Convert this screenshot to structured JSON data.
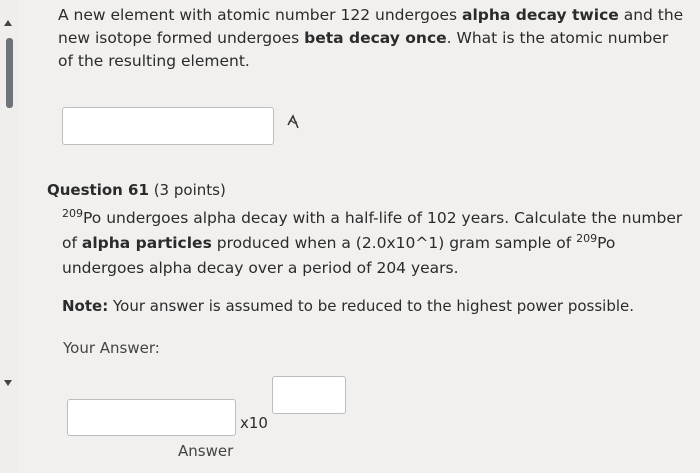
{
  "question_prev": {
    "text_1": "A new element with atomic number 122 undergoes ",
    "bold_1": "alpha decay twice",
    "text_2": " and the new isotope formed undergoes ",
    "bold_2": "beta decay once",
    "text_3": ".  What is the atomic number of the resulting element."
  },
  "equation_icon": "equation-editor-icon",
  "question_61": {
    "header_bold": "Question 61",
    "points": " (3 points)",
    "isotope_mass": "209",
    "isotope_symbol": "Po",
    "text_1": " undergoes alpha decay with a half-life of 102 years.  Calculate the number of ",
    "bold_1": "alpha particles",
    "text_2": " produced when  a (2.0x10^1) gram sample of ",
    "isotope_mass_2": "209",
    "isotope_symbol_2": "Po",
    "text_3": " undergoes alpha decay over a period of 204 years.",
    "note_label": "Note:",
    "note_text": " Your answer is assumed to be reduced to the highest power possible.",
    "your_answer": "Your Answer:",
    "times_ten": "x10",
    "answer_caption": "Answer"
  }
}
